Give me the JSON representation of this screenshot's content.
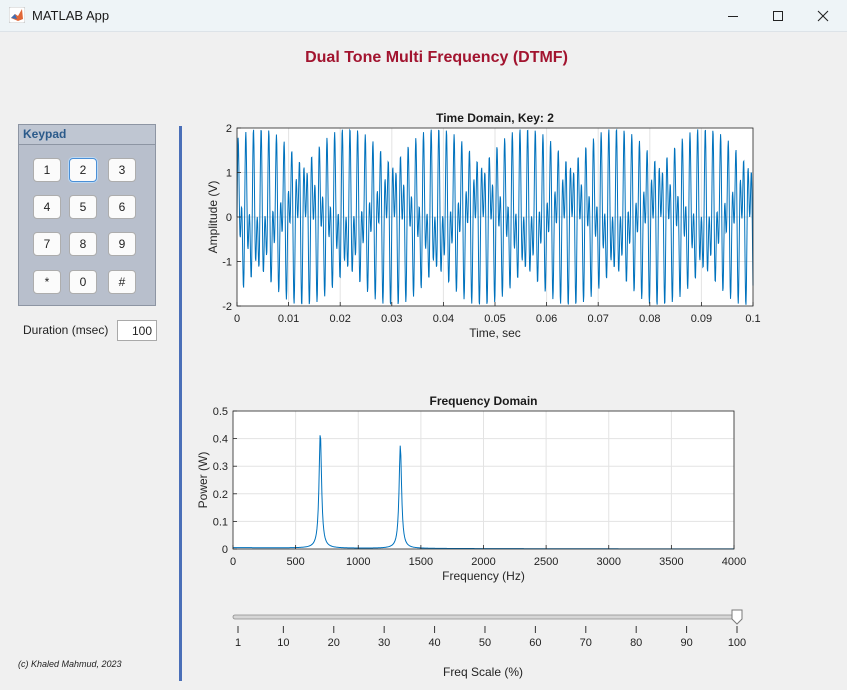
{
  "window": {
    "title": "MATLAB App"
  },
  "app": {
    "heading": "Dual Tone Multi Frequency (DTMF)",
    "credit": "(c) Khaled Mahmud, 2023"
  },
  "keypad": {
    "title": "Keypad",
    "keys": [
      "1",
      "2",
      "3",
      "4",
      "5",
      "6",
      "7",
      "8",
      "9",
      "*",
      "0",
      "#"
    ],
    "selected_key": "2"
  },
  "duration": {
    "label": "Duration (msec)",
    "value": "100"
  },
  "slider": {
    "label": "Freq Scale (%)",
    "value": 100,
    "min": 1,
    "max": 100,
    "tick_labels": [
      "1",
      "10",
      "20",
      "30",
      "40",
      "50",
      "60",
      "70",
      "80",
      "90",
      "100"
    ]
  },
  "colors": {
    "heading": "#a2142f",
    "line": "#0072bd",
    "divider": "#4a6fb8"
  },
  "chart_data": [
    {
      "type": "line",
      "title": "Time Domain, Key: 2",
      "xlabel": "Time, sec",
      "ylabel": "Amplitude (V)",
      "xlim": [
        0,
        0.1
      ],
      "ylim": [
        -2,
        2
      ],
      "xticks": [
        "0",
        "0.01",
        "0.02",
        "0.03",
        "0.04",
        "0.05",
        "0.06",
        "0.07",
        "0.08",
        "0.09",
        "0.1"
      ],
      "yticks": [
        "-2",
        "-1",
        "0",
        "1",
        "2"
      ],
      "grid": true,
      "series": [
        {
          "signal": "sin(2*pi*697*t) + sin(2*pi*1336*t)",
          "tones_hz": [
            697,
            1336
          ]
        }
      ]
    },
    {
      "type": "line",
      "title": "Frequency Domain",
      "xlabel": "Frequency (Hz)",
      "ylabel": "Power (W)",
      "xlim": [
        0,
        4000
      ],
      "ylim": [
        0,
        0.5
      ],
      "xticks": [
        "0",
        "500",
        "1000",
        "1500",
        "2000",
        "2500",
        "3000",
        "3500",
        "4000"
      ],
      "yticks": [
        "0",
        "0.1",
        "0.2",
        "0.3",
        "0.4",
        "0.5"
      ],
      "grid": true,
      "series": [
        {
          "peaks": [
            {
              "x": 697,
              "y": 0.42
            },
            {
              "x": 1336,
              "y": 0.375
            }
          ],
          "baseline": 0.005
        }
      ]
    }
  ]
}
